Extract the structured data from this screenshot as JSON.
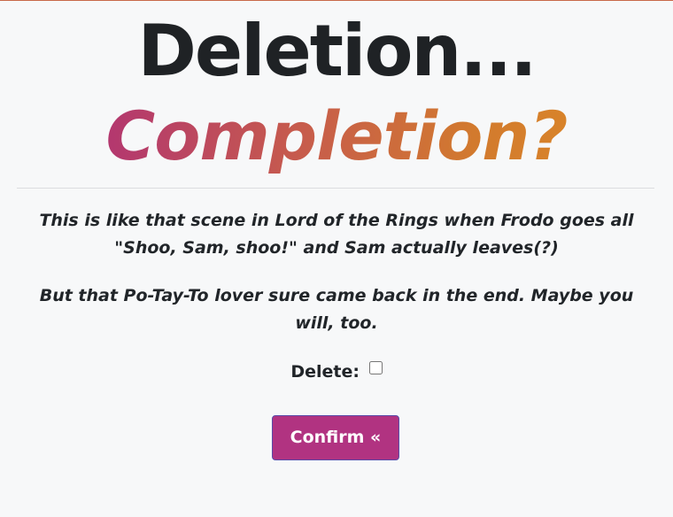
{
  "page": {
    "title_line1": "Deletion...",
    "title_line2": "Completion?",
    "paragraph_1": "This is like that scene in Lord of the Rings when Frodo goes all \"Shoo, Sam, shoo!\" and Sam actually leaves(?)",
    "paragraph_2": "But that Po-Tay-To lover sure came back in the end. Maybe you will, too."
  },
  "form": {
    "delete_label": "Delete:",
    "delete_checked": false,
    "confirm_label": "Confirm «"
  },
  "colors": {
    "accent_button": "#b13381",
    "gradient_start": "#b3376f",
    "gradient_end": "#d8832a",
    "text": "#212529",
    "background": "#f7f8f9"
  }
}
